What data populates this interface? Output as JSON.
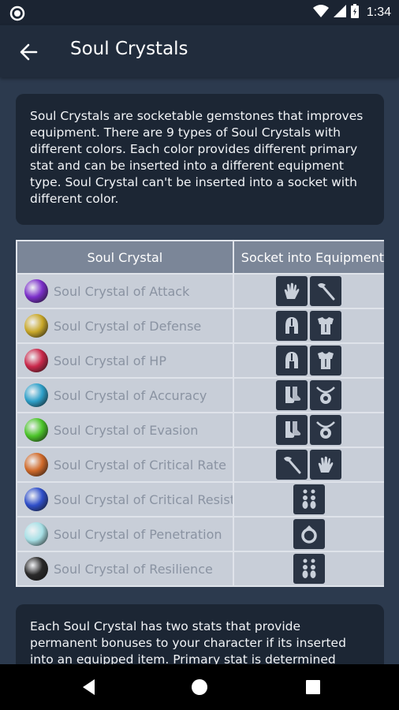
{
  "status": {
    "time": "1:34"
  },
  "app_bar": {
    "title": "Soul Crystals"
  },
  "intro": "Soul Crystals are socketable gemstones that improves equipment. There are 9 types of Soul Crystals with different colors. Each color provides different primary stat and can be inserted into a different equipment type. Soul Crystal can't be inserted into a socket with different color.",
  "table": {
    "headers": [
      "Soul Crystal",
      "Socket into Equipment"
    ],
    "rows": [
      {
        "name": "Soul Crystal of Attack",
        "gem_color": "#7b2fc9",
        "icons": [
          "glove-icon",
          "axe-icon"
        ]
      },
      {
        "name": "Soul Crystal of Defense",
        "gem_color": "#c9a82a",
        "icons": [
          "helmet-icon",
          "armor-icon"
        ]
      },
      {
        "name": "Soul Crystal of HP",
        "gem_color": "#c9284a",
        "icons": [
          "helmet-icon",
          "armor-icon"
        ]
      },
      {
        "name": "Soul Crystal of Accuracy",
        "gem_color": "#2ea0c9",
        "icons": [
          "boots-icon",
          "amulet-icon"
        ]
      },
      {
        "name": "Soul Crystal of Evasion",
        "gem_color": "#4cc42a",
        "icons": [
          "boots-icon",
          "amulet-icon"
        ]
      },
      {
        "name": "Soul Crystal of Critical Rate",
        "gem_color": "#d06a2a",
        "icons": [
          "axe-icon",
          "glove-icon"
        ]
      },
      {
        "name": "Soul Crystal of Critical Resist",
        "gem_color": "#2f4fc9",
        "icons": [
          "earrings-icon"
        ]
      },
      {
        "name": "Soul Crystal of Penetration",
        "gem_color": "#a8e0e6",
        "icons": [
          "ring-icon"
        ]
      },
      {
        "name": "Soul Crystal of Resilience",
        "gem_color": "#2a2a2a",
        "icons": [
          "earrings-icon"
        ]
      }
    ]
  },
  "second_card": "Each Soul Crystal has two stats that provide permanent bonuses to your character if its inserted into an equipped item. Primary stat is determined"
}
